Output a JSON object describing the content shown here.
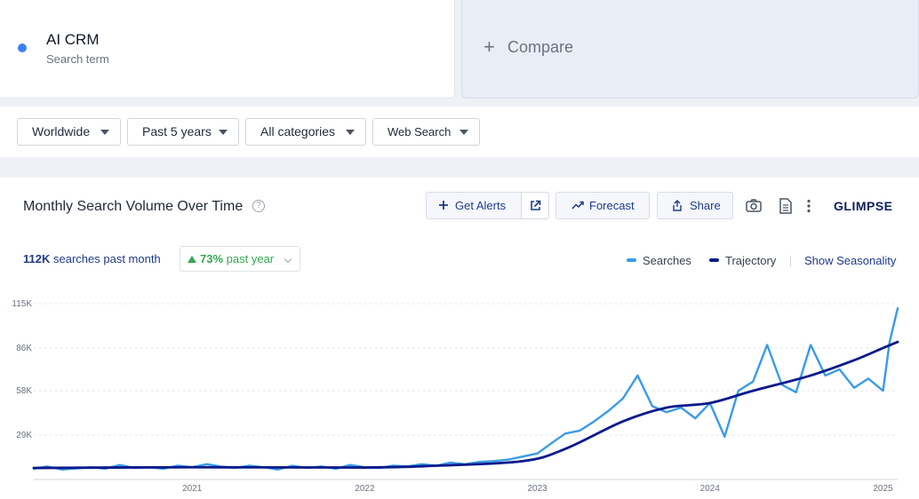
{
  "search_term": {
    "name": "AI CRM",
    "subtitle": "Search term",
    "dot_color": "#3b82f6"
  },
  "compare": {
    "plus": "+",
    "label": "Compare"
  },
  "filters": [
    {
      "label": "Worldwide"
    },
    {
      "label": "Past 5 years"
    },
    {
      "label": "All categories"
    },
    {
      "label": "Web Search"
    }
  ],
  "chart_header": {
    "title": "Monthly Search Volume Over Time",
    "help": "?",
    "get_alerts": "Get Alerts",
    "forecast": "Forecast",
    "share": "Share",
    "logo": "GLIMPSE"
  },
  "stats": {
    "volume": "112K",
    "volume_suffix": "searches past month",
    "growth": "73%",
    "growth_suffix": "past year",
    "growth_color": "#34a853"
  },
  "legend": {
    "searches": "Searches",
    "trajectory": "Trajectory",
    "seasonality": "Show Seasonality"
  },
  "chart_data": {
    "type": "line",
    "title": "Monthly Search Volume Over Time",
    "xlabel": "",
    "ylabel": "",
    "ylim": [
      0,
      115000
    ],
    "xlim": [
      "2020-02-01",
      "2025-02-01"
    ],
    "grid": true,
    "legend_position": "top-right",
    "y_ticks": [
      {
        "value": 29000,
        "label": "29K"
      },
      {
        "value": 58000,
        "label": "58K"
      },
      {
        "value": 86000,
        "label": "86K"
      },
      {
        "value": 115000,
        "label": "115K"
      }
    ],
    "x_ticks": [
      {
        "value": "2021-01-01",
        "label": "2021"
      },
      {
        "value": "2022-01-01",
        "label": "2022"
      },
      {
        "value": "2023-01-01",
        "label": "2023"
      },
      {
        "value": "2024-01-01",
        "label": "2024"
      },
      {
        "value": "2025-01-01",
        "label": "2025"
      }
    ],
    "series": [
      {
        "name": "Searches",
        "color": "#3a9be8",
        "points": [
          [
            "2020-02-01",
            7000
          ],
          [
            "2020-03-01",
            8500
          ],
          [
            "2020-04-01",
            6500
          ],
          [
            "2020-05-01",
            7200
          ],
          [
            "2020-06-01",
            8000
          ],
          [
            "2020-07-01",
            7000
          ],
          [
            "2020-08-01",
            9500
          ],
          [
            "2020-09-01",
            7500
          ],
          [
            "2020-10-01",
            8000
          ],
          [
            "2020-11-01",
            7000
          ],
          [
            "2020-12-01",
            9000
          ],
          [
            "2021-01-01",
            8000
          ],
          [
            "2021-02-01",
            10000
          ],
          [
            "2021-03-01",
            8500
          ],
          [
            "2021-04-01",
            7500
          ],
          [
            "2021-05-01",
            9000
          ],
          [
            "2021-06-01",
            8000
          ],
          [
            "2021-07-01",
            6500
          ],
          [
            "2021-08-01",
            9000
          ],
          [
            "2021-09-01",
            7500
          ],
          [
            "2021-10-01",
            8500
          ],
          [
            "2021-11-01",
            7000
          ],
          [
            "2021-12-01",
            9500
          ],
          [
            "2022-01-01",
            8000
          ],
          [
            "2022-02-01",
            7500
          ],
          [
            "2022-03-01",
            9000
          ],
          [
            "2022-04-01",
            8500
          ],
          [
            "2022-05-01",
            10000
          ],
          [
            "2022-06-01",
            9000
          ],
          [
            "2022-07-01",
            11000
          ],
          [
            "2022-08-01",
            10000
          ],
          [
            "2022-09-01",
            11500
          ],
          [
            "2022-10-01",
            12000
          ],
          [
            "2022-11-01",
            13000
          ],
          [
            "2022-12-01",
            15000
          ],
          [
            "2023-01-01",
            17000
          ],
          [
            "2023-02-01",
            24000
          ],
          [
            "2023-03-01",
            30000
          ],
          [
            "2023-04-01",
            32000
          ],
          [
            "2023-05-01",
            38000
          ],
          [
            "2023-06-01",
            45000
          ],
          [
            "2023-07-01",
            53000
          ],
          [
            "2023-08-01",
            68000
          ],
          [
            "2023-09-01",
            48000
          ],
          [
            "2023-10-01",
            44000
          ],
          [
            "2023-11-01",
            47000
          ],
          [
            "2023-12-01",
            40000
          ],
          [
            "2024-01-01",
            50000
          ],
          [
            "2024-02-01",
            28000
          ],
          [
            "2024-03-01",
            58000
          ],
          [
            "2024-04-01",
            64000
          ],
          [
            "2024-05-01",
            88000
          ],
          [
            "2024-06-01",
            62000
          ],
          [
            "2024-07-01",
            57000
          ],
          [
            "2024-08-01",
            88000
          ],
          [
            "2024-09-01",
            68000
          ],
          [
            "2024-10-01",
            72000
          ],
          [
            "2024-11-01",
            60000
          ],
          [
            "2024-12-01",
            66000
          ],
          [
            "2025-01-01",
            58000
          ],
          [
            "2025-01-15",
            90000
          ],
          [
            "2025-02-01",
            112000
          ]
        ]
      },
      {
        "name": "Trajectory",
        "color": "#0a1a8c",
        "points": [
          [
            "2020-02-01",
            7500
          ],
          [
            "2021-01-01",
            8000
          ],
          [
            "2022-01-01",
            7800
          ],
          [
            "2022-06-01",
            9000
          ],
          [
            "2022-12-01",
            12000
          ],
          [
            "2023-03-01",
            20000
          ],
          [
            "2023-07-01",
            38000
          ],
          [
            "2023-10-01",
            47000
          ],
          [
            "2024-01-01",
            50000
          ],
          [
            "2024-04-01",
            58000
          ],
          [
            "2024-08-01",
            68000
          ],
          [
            "2024-11-01",
            78000
          ],
          [
            "2025-01-01",
            86000
          ],
          [
            "2025-02-01",
            90000
          ]
        ]
      }
    ]
  }
}
